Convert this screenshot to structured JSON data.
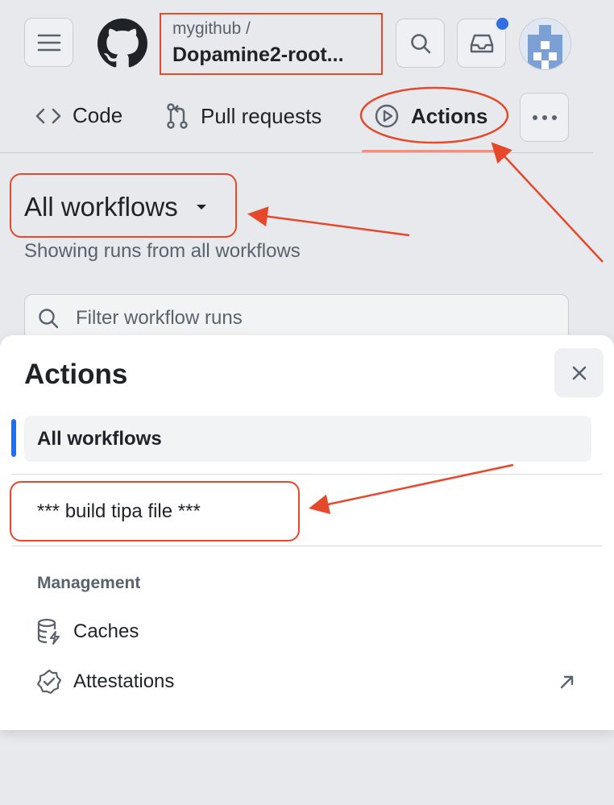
{
  "header": {
    "owner": "mygithub /",
    "repo_name": "Dopamine2-root...",
    "notification_dot_color": "#1f6feb",
    "icons": [
      "menu-icon",
      "github-logo-icon",
      "search-icon",
      "inbox-icon",
      "avatar"
    ]
  },
  "tabs": [
    {
      "label": "Code",
      "icon": "code-icon",
      "active": false
    },
    {
      "label": "Pull requests",
      "icon": "pull-request-icon",
      "active": false
    },
    {
      "label": "Actions",
      "icon": "play-icon",
      "active": true
    }
  ],
  "workflows": {
    "title": "All workflows",
    "subtitle": "Showing runs from all workflows",
    "filter_placeholder": "Filter workflow runs"
  },
  "sheet": {
    "title": "Actions",
    "items": [
      {
        "label": "All workflows",
        "selected": true
      },
      {
        "label": "*** build tipa file ***",
        "selected": false
      }
    ],
    "management_heading": "Management",
    "management_items": [
      {
        "label": "Caches",
        "icon": "cache-icon"
      },
      {
        "label": "Attestations",
        "icon": "attestation-icon",
        "external": true
      }
    ]
  },
  "colors": {
    "accent": "#1f6feb",
    "active_tab_underline": "#fd8c73",
    "annotation": "#e5482b"
  }
}
